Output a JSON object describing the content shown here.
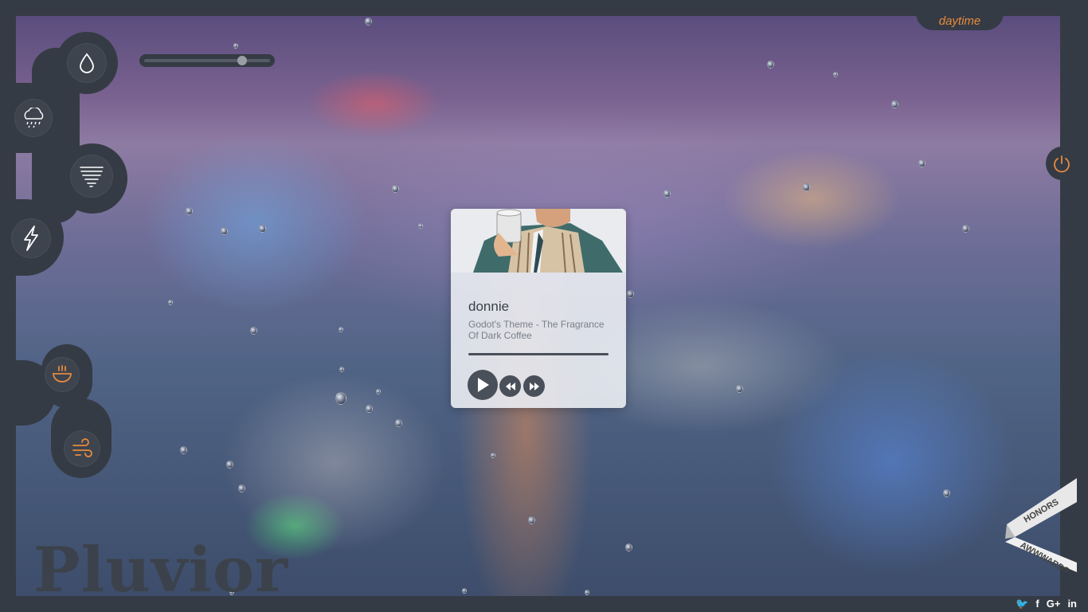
{
  "app": {
    "logo_text": "Pluvior"
  },
  "mode_tab": {
    "label": "daytime"
  },
  "volume": {
    "level": 0.8
  },
  "controls": {
    "left_effects": [
      "rain-drop-icon",
      "rain-cloud-icon",
      "wind-swirl-icon",
      "lightning-icon"
    ],
    "left_extras": [
      "coffee-icon",
      "wind-icon"
    ],
    "right": [
      "power-icon"
    ]
  },
  "player": {
    "artist": "donnie",
    "track": "Godot's Theme - The Fragrance Of Dark Coffee",
    "progress": 1.0,
    "buttons": [
      "play-icon",
      "rewind-icon",
      "fast-forward-icon"
    ]
  },
  "badge": {
    "top": "HONORS",
    "bottom": "AWWWARDS"
  },
  "social": {
    "twitter": "🐦",
    "facebook": "f",
    "googleplus": "G+",
    "linkedin": "in"
  },
  "colors": {
    "accent": "#e88a3e",
    "panel": "#353b44",
    "icon": "#ffffff"
  }
}
